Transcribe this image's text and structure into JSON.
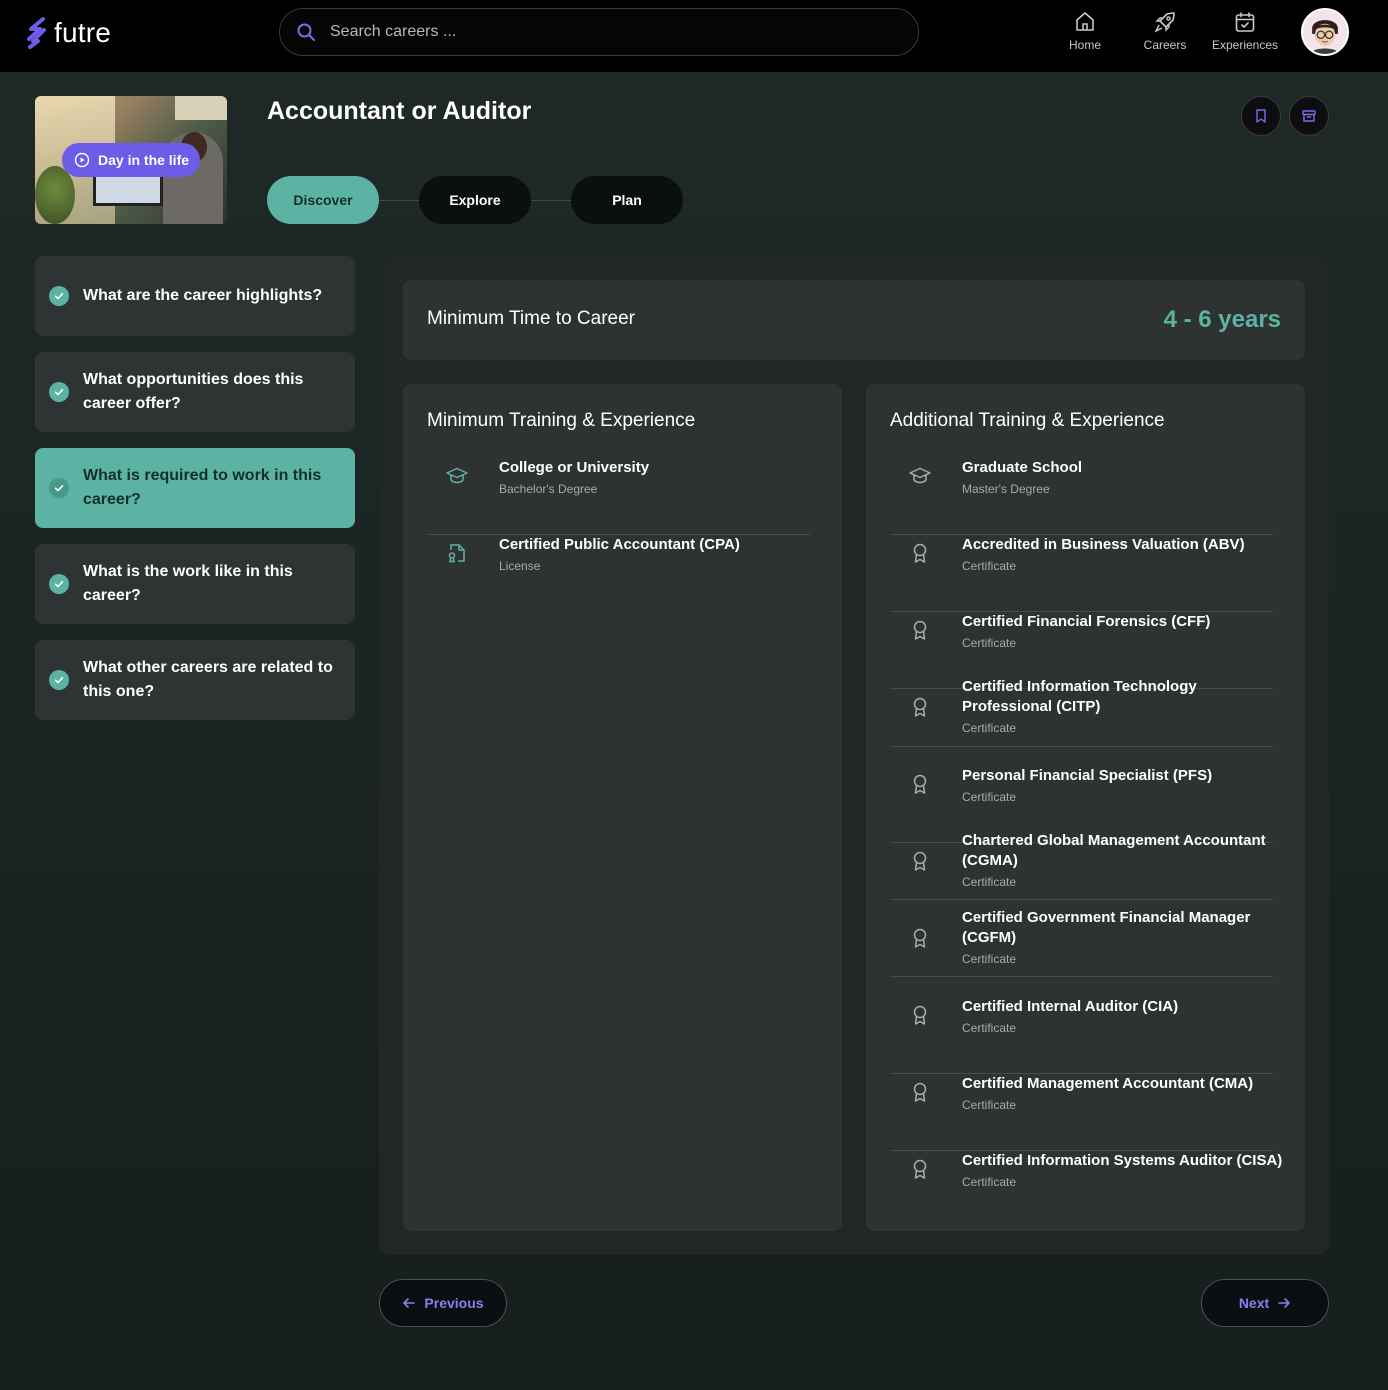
{
  "brand": {
    "name": "futre",
    "accent": "#6c5ce7",
    "teal": "#5db3a3"
  },
  "search": {
    "placeholder": "Search careers ...",
    "value": ""
  },
  "nav": [
    {
      "label": "Home",
      "icon": "home-icon"
    },
    {
      "label": "Careers",
      "icon": "rocket-icon"
    },
    {
      "label": "Experiences",
      "icon": "calendar-check-icon"
    }
  ],
  "header": {
    "title": "Accountant or Auditor",
    "video_label": "Day in the life",
    "steps": [
      {
        "label": "Discover",
        "active": true
      },
      {
        "label": "Explore",
        "active": false
      },
      {
        "label": "Plan",
        "active": false
      }
    ]
  },
  "sidebar": {
    "items": [
      {
        "label": "What are the career highlights?",
        "active": false
      },
      {
        "label": "What opportunities does this career offer?",
        "active": false
      },
      {
        "label": "What is required to work in this career?",
        "active": true
      },
      {
        "label": "What is the work like in this career?",
        "active": false
      },
      {
        "label": "What other careers are related to this one?",
        "active": false
      }
    ]
  },
  "time_to_career": {
    "label": "Minimum Time to Career",
    "value": "4 - 6 years"
  },
  "minimum": {
    "title": "Minimum Training & Experience",
    "entries": [
      {
        "title": "College or University",
        "subtitle": "Bachelor's Degree",
        "icon": "graduation-cap-icon"
      },
      {
        "title": "Certified Public Accountant (CPA)",
        "subtitle": "License",
        "icon": "license-document-icon"
      }
    ]
  },
  "additional": {
    "title": "Additional Training & Experience",
    "entries": [
      {
        "title": "Graduate School",
        "subtitle": "Master's Degree",
        "icon": "graduation-cap-icon"
      },
      {
        "title": "Accredited in Business Valuation (ABV)",
        "subtitle": "Certificate",
        "icon": "award-ribbon-icon"
      },
      {
        "title": "Certified Financial Forensics (CFF)",
        "subtitle": "Certificate",
        "icon": "award-ribbon-icon"
      },
      {
        "title": "Certified Information Technology Professional (CITP)",
        "subtitle": "Certificate",
        "icon": "award-ribbon-icon"
      },
      {
        "title": "Personal Financial Specialist (PFS)",
        "subtitle": "Certificate",
        "icon": "award-ribbon-icon"
      },
      {
        "title": "Chartered Global Management Accountant (CGMA)",
        "subtitle": "Certificate",
        "icon": "award-ribbon-icon"
      },
      {
        "title": "Certified Government Financial Manager (CGFM)",
        "subtitle": "Certificate",
        "icon": "award-ribbon-icon"
      },
      {
        "title": "Certified Internal Auditor (CIA)",
        "subtitle": "Certificate",
        "icon": "award-ribbon-icon"
      },
      {
        "title": "Certified Management Accountant (CMA)",
        "subtitle": "Certificate",
        "icon": "award-ribbon-icon"
      },
      {
        "title": "Certified Information Systems Auditor (CISA)",
        "subtitle": "Certificate",
        "icon": "award-ribbon-icon"
      }
    ]
  },
  "pager": {
    "previous": "Previous",
    "next": "Next"
  }
}
